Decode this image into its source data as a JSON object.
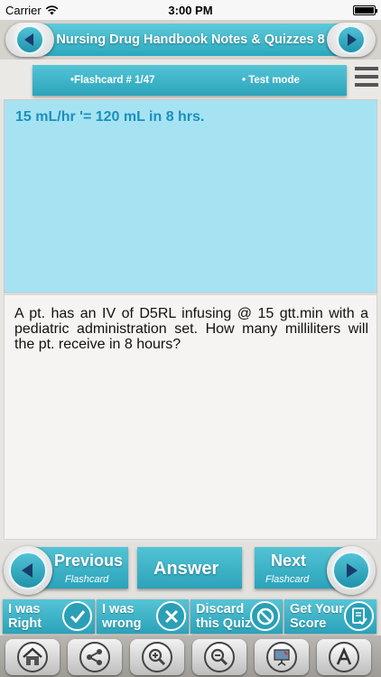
{
  "status_bar": {
    "carrier": "Carrier",
    "time": "3:00 PM"
  },
  "header": {
    "title": "Nursing Drug Handbook Notes & Quizzes 8"
  },
  "flashcard": {
    "number": "•Flashcard #  1/47",
    "mode": "• Test mode"
  },
  "answer": {
    "text": "15 mL/hr '= 120 mL in 8 hrs."
  },
  "question": {
    "text": "A pt. has an IV of D5RL infusing @ 15 gtt.min with a pediatric administration set. How many milliliters will the pt. receive in 8 hours?"
  },
  "nav": {
    "previous_label": "Previous",
    "previous_sub": "Flashcard",
    "answer_label": "Answer",
    "next_label": "Next",
    "next_sub": "Flashcard"
  },
  "actions": {
    "right_line1": "I was",
    "right_line2": "Right",
    "wrong_line1": "I was",
    "wrong_line2": "wrong",
    "discard_line1": "Discard",
    "discard_line2": "this Quiz",
    "score_line1": "Get Your",
    "score_line2": "Score"
  },
  "colors": {
    "accent": "#2ba5bb",
    "answer_bg": "#a6e3f2",
    "answer_text": "#1b8fbf"
  },
  "icons": {
    "toolbar": [
      "home-icon",
      "share-icon",
      "zoom-in-icon",
      "zoom-out-icon",
      "presentation-icon",
      "font-icon"
    ]
  }
}
